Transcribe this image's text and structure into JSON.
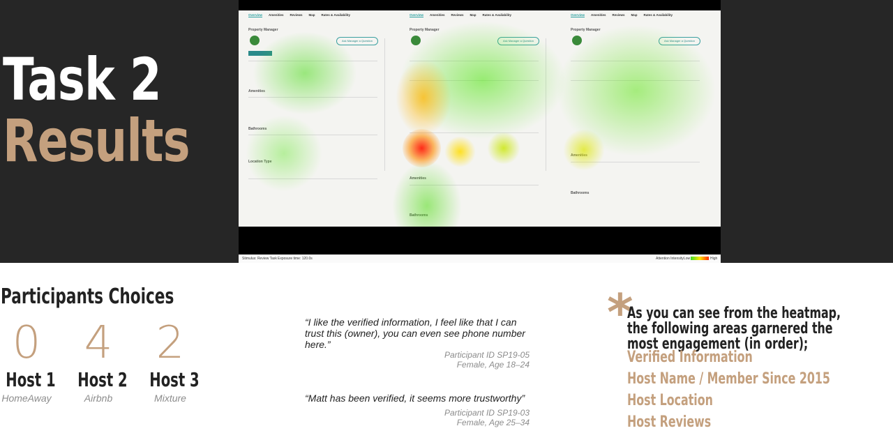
{
  "title": {
    "line1": "Task 2",
    "line2": "Results"
  },
  "heatmap": {
    "nav_tabs": [
      "Overview",
      "Amenities",
      "Reviews",
      "Map",
      "Rates & Availability"
    ],
    "property_manager_label": "Property Manager",
    "ask_button": "Ask Manager a Question",
    "amenities_label": "Amenities",
    "bathrooms_label": "Bathrooms",
    "location_label": "Location Type",
    "footer_stimulus": "Stimulus: Review Task",
    "footer_exposure": "Exposure time: 120.0s",
    "footer_attention": "Attention Intensity",
    "footer_low": "Low",
    "footer_high": "High"
  },
  "participants": {
    "title": "Participants Choices",
    "choices": [
      {
        "count": "0",
        "host": "Host 1",
        "platform": "HomeAway"
      },
      {
        "count": "4",
        "host": "Host 2",
        "platform": "Airbnb"
      },
      {
        "count": "2",
        "host": "Host 3",
        "platform": "Mixture"
      }
    ]
  },
  "quotes": [
    {
      "text": "“I like the verified information, I feel like that I can trust this (owner), you can even see phone number here.”",
      "id": "Participant ID SP19-05",
      "demo": "Female, Age 18–24"
    },
    {
      "text": "“Matt has been verified, it seems more trustworthy”",
      "id": "Participant ID SP19-03",
      "demo": "Female, Age 25–34"
    }
  ],
  "insight": {
    "star": "*",
    "text": "As you can see from the heatmap, the following areas garnered the most engagement (in order);",
    "areas": [
      "Verified Information",
      "Host Name / Member Since 2015",
      "Host Location",
      "Host Reviews"
    ]
  },
  "colors": {
    "accent": "#c4a07e",
    "dark_bg": "#262626"
  }
}
